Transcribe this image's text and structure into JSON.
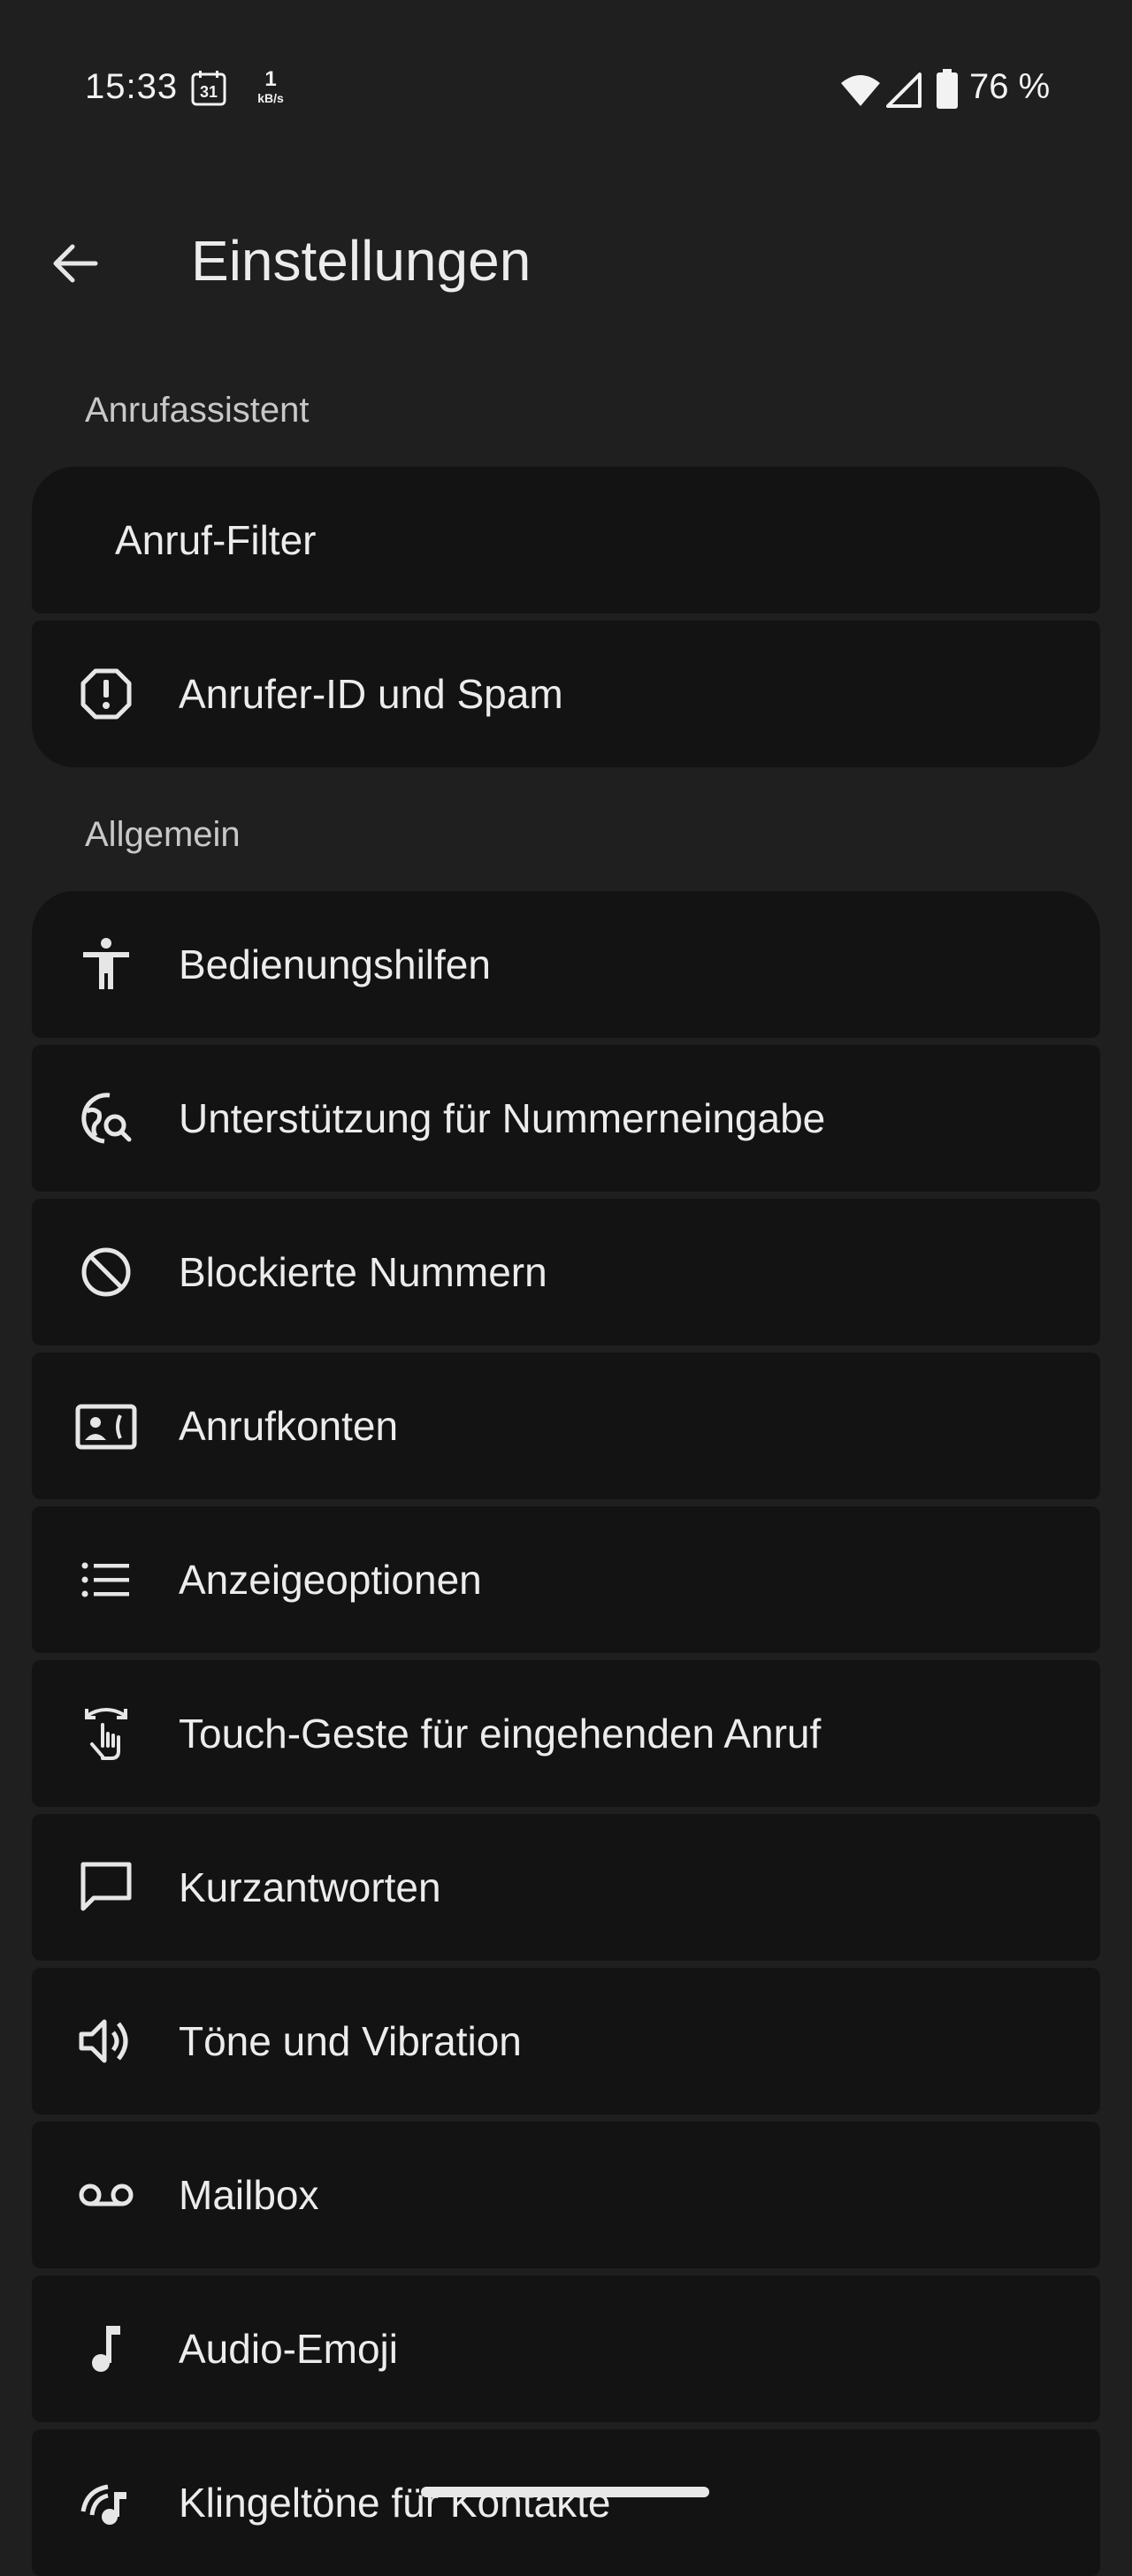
{
  "status_bar": {
    "time": "15:33",
    "calendar_day": "31",
    "speed_value": "1",
    "speed_unit": "kB/s",
    "battery": "76 %"
  },
  "header": {
    "title": "Einstellungen"
  },
  "sections": [
    {
      "title": "Anrufassistent",
      "items": [
        {
          "label": "Anruf-Filter",
          "icon": "none"
        },
        {
          "label": "Anrufer-ID und Spam",
          "icon": "alert-octagon-icon"
        }
      ]
    },
    {
      "title": "Allgemein",
      "items": [
        {
          "label": "Bedienungshilfen",
          "icon": "accessibility-icon"
        },
        {
          "label": "Unterstützung für Nummerneingabe",
          "icon": "globe-search-icon"
        },
        {
          "label": "Blockierte Nummern",
          "icon": "block-icon"
        },
        {
          "label": "Anrufkonten",
          "icon": "contact-phone-icon"
        },
        {
          "label": "Anzeigeoptionen",
          "icon": "list-icon"
        },
        {
          "label": "Touch-Geste für eingehenden Anruf",
          "icon": "swipe-gesture-icon"
        },
        {
          "label": "Kurzantworten",
          "icon": "chat-bubble-icon"
        },
        {
          "label": "Töne und Vibration",
          "icon": "volume-icon"
        },
        {
          "label": "Mailbox",
          "icon": "voicemail-icon"
        },
        {
          "label": "Audio-Emoji",
          "icon": "music-note-icon"
        },
        {
          "label": "Klingeltöne für Kontakte",
          "icon": "ringtone-icon"
        }
      ]
    }
  ],
  "colors": {
    "background": "#1f1f20",
    "card": "#131314",
    "text": "#ececec",
    "section_label": "#c8c8c8"
  }
}
